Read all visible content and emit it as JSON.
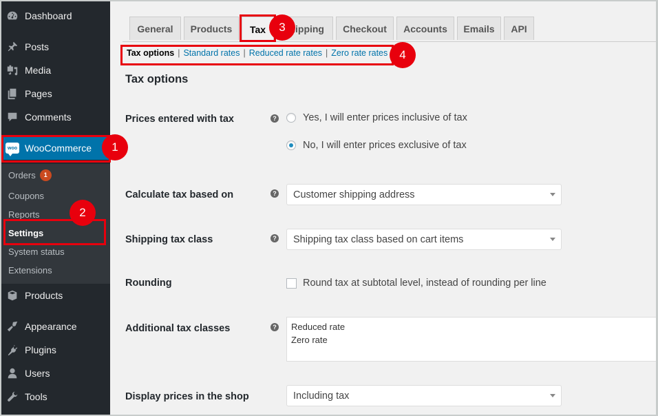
{
  "sidebar": {
    "items": [
      {
        "label": "Dashboard",
        "icon": "dashboard-icon"
      },
      {
        "label": "Posts",
        "icon": "pin-icon"
      },
      {
        "label": "Media",
        "icon": "media-icon"
      },
      {
        "label": "Pages",
        "icon": "pages-icon"
      },
      {
        "label": "Comments",
        "icon": "comment-icon"
      },
      {
        "label": "WooCommerce",
        "icon": "woo-icon",
        "logo_text": "woo"
      },
      {
        "label": "Products",
        "icon": "box-icon"
      },
      {
        "label": "Appearance",
        "icon": "brush-icon"
      },
      {
        "label": "Plugins",
        "icon": "plug-icon"
      },
      {
        "label": "Users",
        "icon": "user-icon"
      },
      {
        "label": "Tools",
        "icon": "wrench-icon"
      }
    ],
    "submenu": [
      {
        "label": "Orders",
        "badge": "1"
      },
      {
        "label": "Coupons"
      },
      {
        "label": "Reports"
      },
      {
        "label": "Settings",
        "current": true
      },
      {
        "label": "System status"
      },
      {
        "label": "Extensions"
      }
    ]
  },
  "tabs": [
    {
      "label": "General"
    },
    {
      "label": "Products"
    },
    {
      "label": "Tax",
      "active": true
    },
    {
      "label": "Shipping"
    },
    {
      "label": "Checkout"
    },
    {
      "label": "Accounts"
    },
    {
      "label": "Emails"
    },
    {
      "label": "API"
    }
  ],
  "subsections": {
    "current": "Tax options",
    "links": [
      "Standard rates",
      "Reduced rate rates",
      "Zero rate rates"
    ],
    "separator": "|"
  },
  "page": {
    "title": "Tax options",
    "help_glyph": "?",
    "prices_entered": {
      "label": "Prices entered with tax",
      "options": [
        {
          "label": "Yes, I will enter prices inclusive of tax",
          "checked": false
        },
        {
          "label": "No, I will enter prices exclusive of tax",
          "checked": true
        }
      ]
    },
    "calculate_based_on": {
      "label": "Calculate tax based on",
      "value": "Customer shipping address"
    },
    "shipping_tax_class": {
      "label": "Shipping tax class",
      "value": "Shipping tax class based on cart items"
    },
    "rounding": {
      "label": "Rounding",
      "checkbox_label": "Round tax at subtotal level, instead of rounding per line",
      "checked": false
    },
    "additional_classes": {
      "label": "Additional tax classes",
      "value": "Reduced rate\nZero rate"
    },
    "display_prices": {
      "label": "Display prices in the shop",
      "value": "Including tax"
    }
  },
  "annotations": [
    "1",
    "2",
    "3",
    "4"
  ],
  "colors": {
    "accent": "#0073aa",
    "annotation": "#e8000d",
    "sidebar": "#23282d",
    "badge": "#ca4a1f"
  }
}
